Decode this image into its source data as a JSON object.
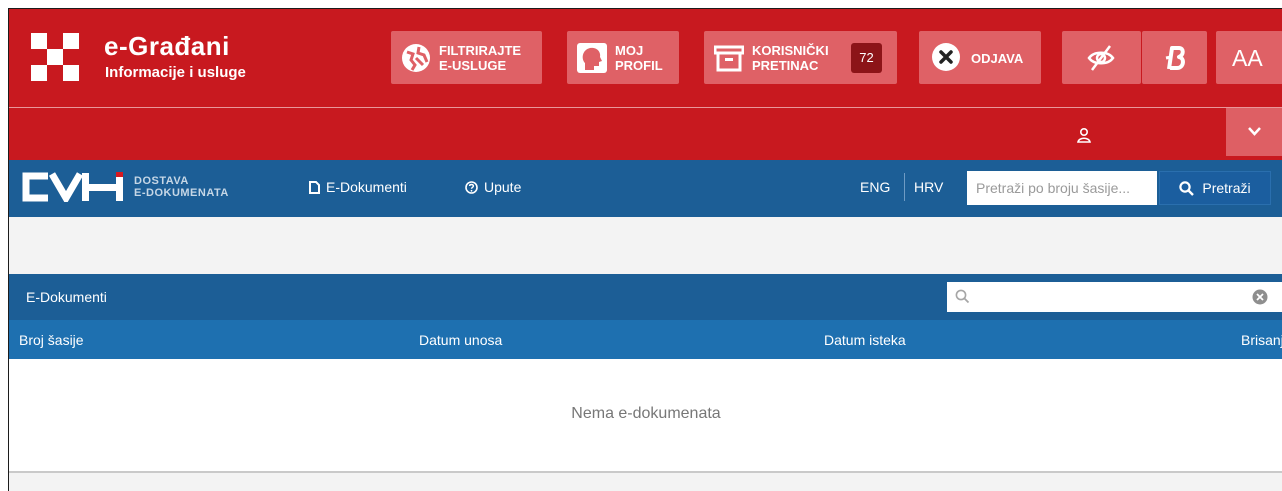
{
  "header": {
    "title": "e-Građani",
    "subtitle": "Informacije i usluge",
    "buttons": {
      "filter_line1": "FILTRIRAJTE",
      "filter_line2": "E-USLUGE",
      "profile_line1": "MOJ",
      "profile_line2": "PROFIL",
      "mailbox_line1": "KORISNIČKI",
      "mailbox_line2": "PRETINAC",
      "mailbox_count": "72",
      "logout": "ODJAVA",
      "font_size": "AA"
    },
    "accent_color": "#c8191f"
  },
  "cvh": {
    "sub_line1": "DOSTAVA",
    "sub_line2": "E-DOKUMENATA",
    "nav": {
      "edokumenti": "E-Dokumenti",
      "upute": "Upute"
    },
    "lang_eng": "ENG",
    "lang_hrv": "HRV",
    "search_placeholder": "Pretraži po broju šasije...",
    "search_button": "Pretraži",
    "color": "#1c5e96"
  },
  "panel": {
    "title": "E-Dokumenti",
    "filter_placeholder": "",
    "columns": [
      "Broj šasije",
      "Datum unosa",
      "Datum isteka",
      "Brisanje"
    ],
    "empty_message": "Nema e-dokumenata"
  }
}
